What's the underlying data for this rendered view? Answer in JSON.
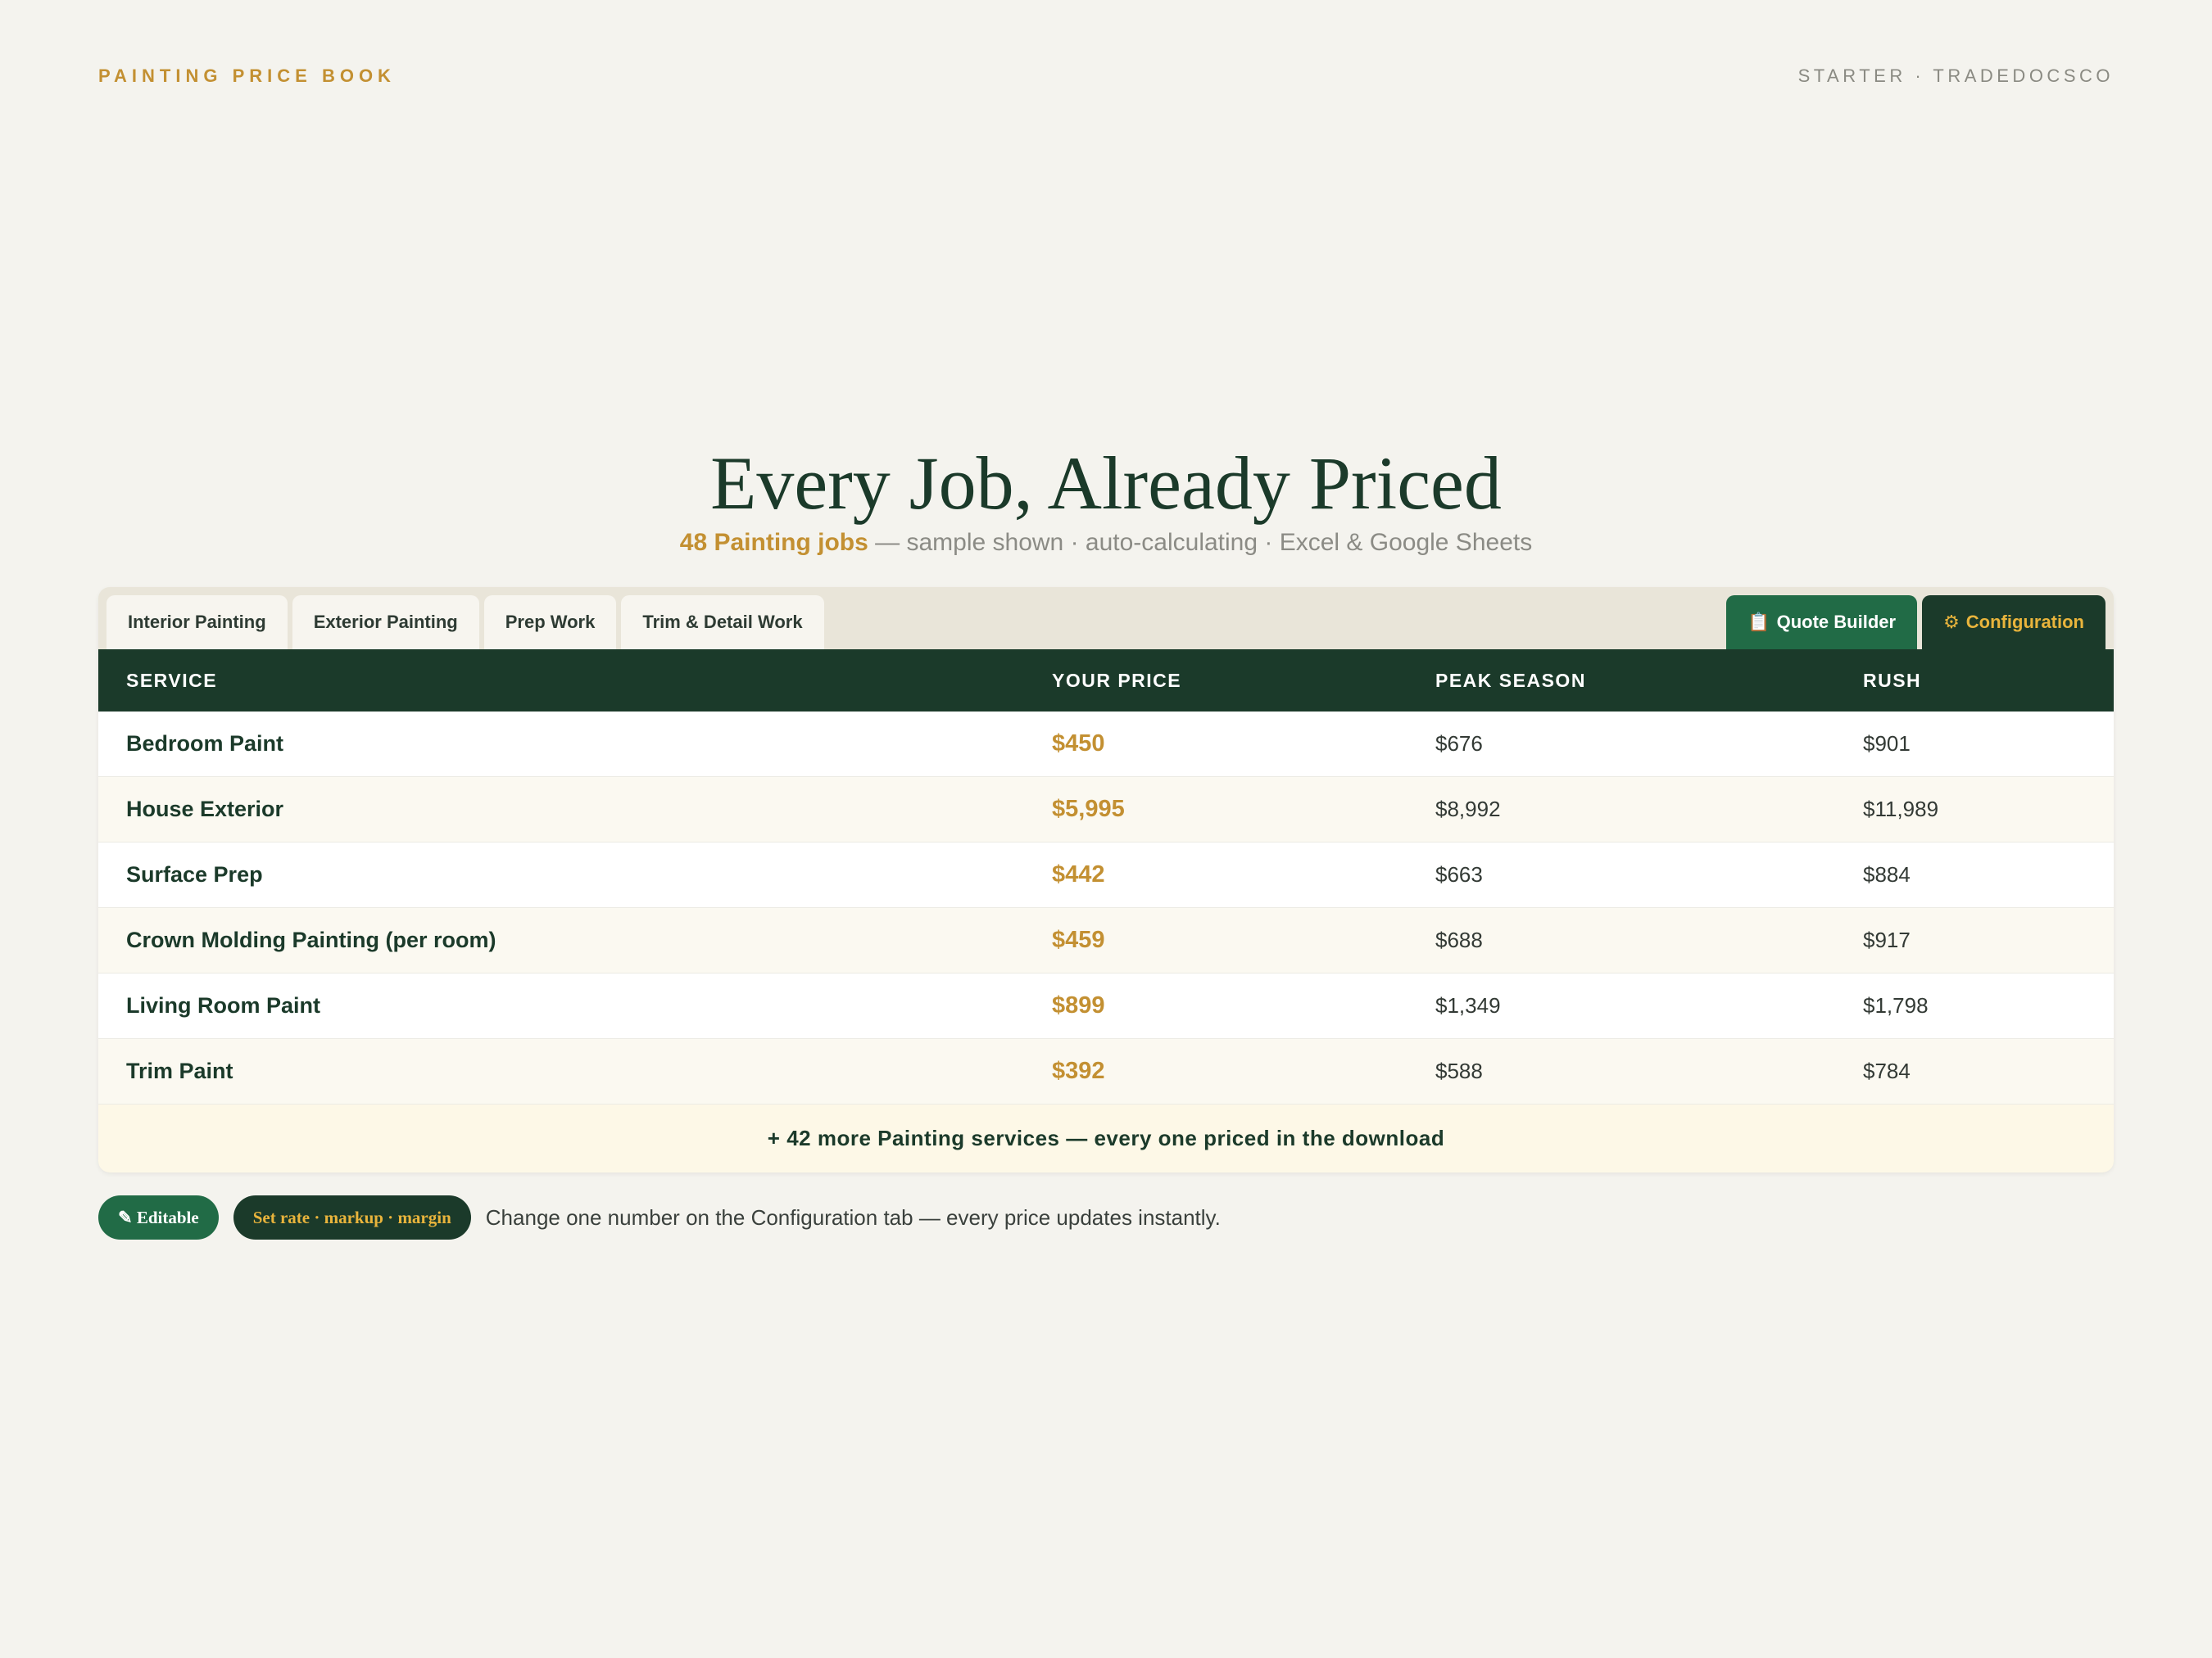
{
  "header": {
    "brand": "PAINTING PRICE BOOK",
    "meta": "STARTER · TRADEDOCSCO"
  },
  "hero": {
    "title": "Every Job, Already Priced",
    "count": "48 Painting jobs",
    "subtitle_rest": " — sample shown · auto-calculating · Excel & Google Sheets"
  },
  "tabs": [
    {
      "label": "Interior Painting"
    },
    {
      "label": "Exterior Painting"
    },
    {
      "label": "Prep Work"
    },
    {
      "label": "Trim & Detail Work"
    }
  ],
  "right_tabs": {
    "quote": {
      "icon": "📋",
      "label": "Quote Builder"
    },
    "config": {
      "icon": "⚙",
      "label": "Configuration"
    }
  },
  "table": {
    "columns": [
      "SERVICE",
      "YOUR PRICE",
      "PEAK SEASON",
      "RUSH"
    ],
    "rows": [
      {
        "service": "Bedroom Paint",
        "your": "$450",
        "peak": "$676",
        "rush": "$901"
      },
      {
        "service": "House Exterior",
        "your": "$5,995",
        "peak": "$8,992",
        "rush": "$11,989"
      },
      {
        "service": "Surface Prep",
        "your": "$442",
        "peak": "$663",
        "rush": "$884"
      },
      {
        "service": "Crown Molding Painting (per room)",
        "your": "$459",
        "peak": "$688",
        "rush": "$917"
      },
      {
        "service": "Living Room Paint",
        "your": "$899",
        "peak": "$1,349",
        "rush": "$1,798"
      },
      {
        "service": "Trim Paint",
        "your": "$392",
        "peak": "$588",
        "rush": "$784"
      }
    ],
    "more": "+ 42 more Painting services — every one priced in the download"
  },
  "footer": {
    "editable": "✎ Editable",
    "rate": "Set rate · markup · margin",
    "note": "Change one number on the Configuration tab — every price updates instantly."
  },
  "colors": {
    "background": "#f4f3ee",
    "dark_green": "#1b3a2a",
    "green": "#216b46",
    "gold": "#c39032"
  }
}
